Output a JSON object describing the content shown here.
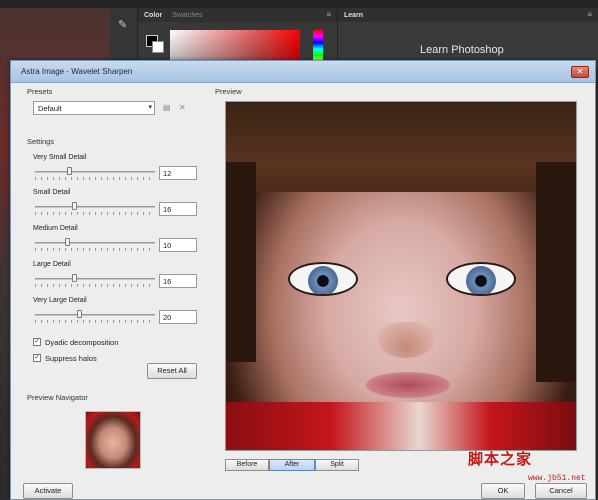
{
  "photoshop": {
    "tabs": {
      "color": "Color",
      "swatches": "Swatches",
      "learn": "Learn"
    },
    "learn_title": "Learn Photoshop"
  },
  "dialog": {
    "title": "Astra Image - Wavelet Sharpen",
    "close_glyph": "✕",
    "presets": {
      "label": "Presets",
      "selected": "Default"
    },
    "settings": {
      "label": "Settings",
      "sliders": [
        {
          "label": "Very Small Detail",
          "value": "12",
          "position": 0.12
        },
        {
          "label": "Small Detail",
          "value": "16",
          "position": 0.16
        },
        {
          "label": "Medium Detail",
          "value": "10",
          "position": 0.1
        },
        {
          "label": "Large Detail",
          "value": "16",
          "position": 0.16
        },
        {
          "label": "Very Large Detail",
          "value": "20",
          "position": 0.2
        }
      ],
      "checkboxes": [
        {
          "label": "Dyadic decomposition",
          "checked": true
        },
        {
          "label": "Suppress halos",
          "checked": true
        }
      ],
      "reset_label": "Reset All"
    },
    "navigator_label": "Preview Navigator",
    "preview": {
      "label": "Preview",
      "toggles": [
        "Before",
        "After",
        "Split"
      ],
      "active_toggle": "After"
    },
    "footer": {
      "activate": "Activate",
      "ok": "OK",
      "cancel": "Cancel"
    }
  },
  "watermark": {
    "main": "脚本之家",
    "url": "www.jb51.net"
  }
}
